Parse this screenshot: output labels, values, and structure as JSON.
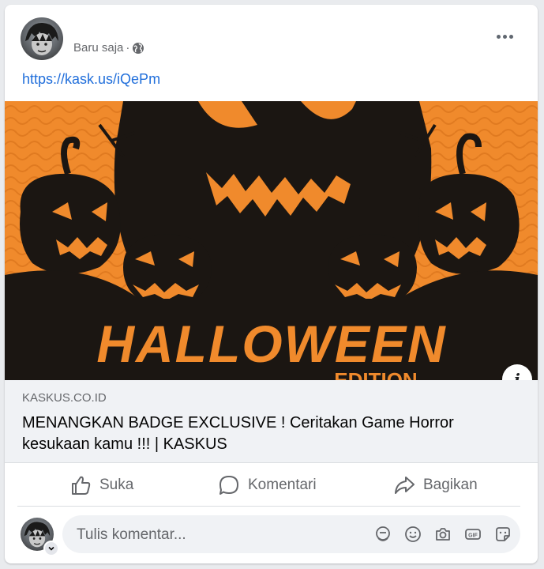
{
  "post": {
    "timestamp": "Baru saja",
    "separator": "·",
    "privacy_icon": "globe-icon",
    "link_text": "https://kask.us/iQePm"
  },
  "link_preview": {
    "image_text": "HALLOWEEN",
    "image_subtext": "EDITION",
    "domain": "KASKUS.CO.ID",
    "title": "MENANGKAN BADGE EXCLUSIVE ! Ceritakan Game Horror kesukaan kamu !!! | KASKUS",
    "info_label": "i"
  },
  "actions": {
    "like": "Suka",
    "comment": "Komentari",
    "share": "Bagikan"
  },
  "comment": {
    "placeholder": "Tulis komentar...",
    "icons": [
      "avatar-sticker-icon",
      "emoji-icon",
      "camera-icon",
      "gif-icon",
      "sticker-icon"
    ]
  },
  "colors": {
    "link": "#216fdb",
    "halloween_orange": "#f08a2c",
    "secondary_text": "#65676b"
  }
}
